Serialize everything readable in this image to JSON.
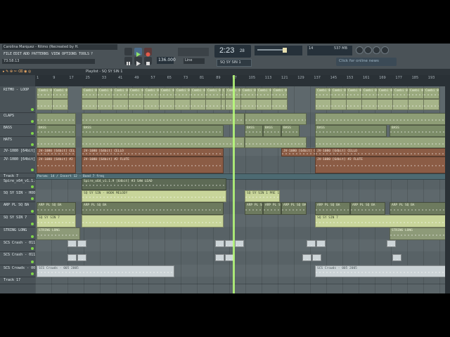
{
  "title": "Carolina Marquez - Ritmo (Recreated by H.",
  "menu": [
    "FILE",
    "EDIT",
    "ADD",
    "PATTERNS",
    "VIEW",
    "OPTIONS",
    "TOOLS",
    "?"
  ],
  "hint": "73:58:13",
  "tempo": "136.000",
  "time": "2:23",
  "time_ms": "28",
  "pattern": "SQ SY SIN 1",
  "cpu": "537 MB",
  "cpu_val": "14",
  "news": "Click for online news",
  "line_mode": "Line",
  "playlist_title": "Playlist - SQ SY SIN 1",
  "tracks": [
    {
      "name": "RITMO - LOOP",
      "h": 37
    },
    {
      "name": "CLAPS",
      "h": 17
    },
    {
      "name": "BASS",
      "h": 17
    },
    {
      "name": "HATS",
      "h": 16
    },
    {
      "name": "JV-1080 [64bit] CELLO",
      "h": 12
    },
    {
      "name": "JV-1080 [64bit] #2 FLUTE",
      "h": 24
    },
    {
      "name": "Track 7",
      "h": 7
    },
    {
      "name": "Spire_x64_v1.1.9 [64bit] #3 SAW LEAD",
      "h": 17
    },
    {
      "name": "SQ SY SIN - HOOK MELODY",
      "h": 17
    },
    {
      "name": "ARP PL SQ BA",
      "h": 18
    },
    {
      "name": "SQ SY SIN 7",
      "h": 18
    },
    {
      "name": "STRING LONG",
      "h": 18
    },
    {
      "name": "SCS Crash - 011",
      "h": 17
    },
    {
      "name": "SCS Crash - 011 #2",
      "h": 19
    },
    {
      "name": "SCS Crowds - 005 2005",
      "h": 17
    },
    {
      "name": "Track 17",
      "h": 10
    }
  ],
  "clips": {
    "loop": "Combi 8-1",
    "claps": "",
    "bass": "BASS",
    "cello": "JV-1080 [64bit] CELLO",
    "flute": "JV-1080 [64bit] #2 FLUTE",
    "auto": "Param: 14 / Insert 12 - Band 7 freq",
    "saw": "Spire_x64_v1.1.9 [64bit] #3 SAW LEAD",
    "hook": "SQ SY SIN - HOOK MELODY",
    "sqpre": "SQ SY SIN 1 PRE 1",
    "arp": "ARP PL SQ BA",
    "sin7": "SQ SY SIN 7",
    "string": "STRING LONG",
    "crowds": "SCS Crowds - 005 2005"
  },
  "ruler_nums": [
    "1",
    "9",
    "17",
    "25",
    "33",
    "41",
    "49",
    "57",
    "65",
    "73",
    "81",
    "89",
    "97",
    "105",
    "113",
    "121",
    "129",
    "137",
    "145",
    "153",
    "161",
    "169",
    "177",
    "185",
    "193"
  ],
  "colors": {
    "accent": "#b8ff7a",
    "clip_green": "#8a9b6a",
    "clip_brown": "#8b5c45",
    "clip_light": "#c9d79a"
  }
}
